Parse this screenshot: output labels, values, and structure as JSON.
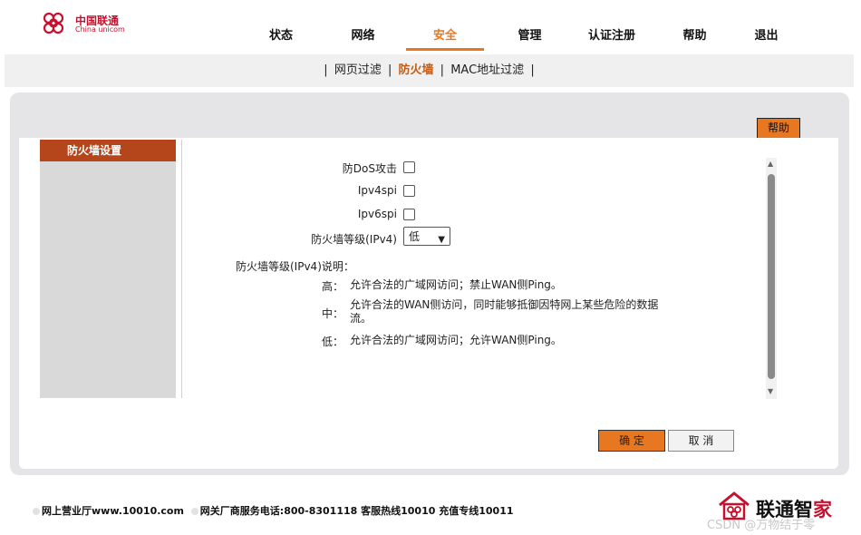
{
  "logo": {
    "text_cn": "中国联通",
    "text_en": "China unicom",
    "color": "#c8102e"
  },
  "nav": {
    "items": [
      {
        "label": "状态"
      },
      {
        "label": "网络"
      },
      {
        "label": "安全"
      },
      {
        "label": "管理"
      },
      {
        "label": "认证注册"
      },
      {
        "label": "帮助"
      },
      {
        "label": "退出"
      }
    ],
    "active_index": 2,
    "accent_color": "#e87722"
  },
  "subnav": {
    "items": [
      "网页过滤",
      "防火墙",
      "MAC地址过滤"
    ],
    "active_index": 1,
    "separator": "|"
  },
  "help_button": "帮助",
  "sidebar": {
    "title": "防火墙设置"
  },
  "form": {
    "dos_label": "防DoS攻击",
    "dos_checked": false,
    "ipv4spi_label": "Ipv4spi",
    "ipv4spi_checked": false,
    "ipv6spi_label": "Ipv6spi",
    "ipv6spi_checked": false,
    "level_label": "防火墙等级(IPv4)",
    "level_value": "低"
  },
  "description": {
    "title": "防火墙等级(IPv4)说明：",
    "levels": [
      {
        "name": "高：",
        "text": "允许合法的广域网访问；禁止WAN侧Ping。"
      },
      {
        "name": "中：",
        "text": "允许合法的WAN侧访问，同时能够抵御因特网上某些危险的数据流。"
      },
      {
        "name": "低：",
        "text": "允许合法的广域网访问；允许WAN侧Ping。"
      }
    ]
  },
  "buttons": {
    "ok": "确 定",
    "cancel": "取 消"
  },
  "footer": {
    "item1": "网上营业厅www.10010.com",
    "item2": "网关厂商服务电话:800-8301118 客服热线10010 充值专线10011"
  },
  "brand": {
    "text_black": "联通智",
    "text_red": "家"
  },
  "watermark": "CSDN @万物结于零"
}
